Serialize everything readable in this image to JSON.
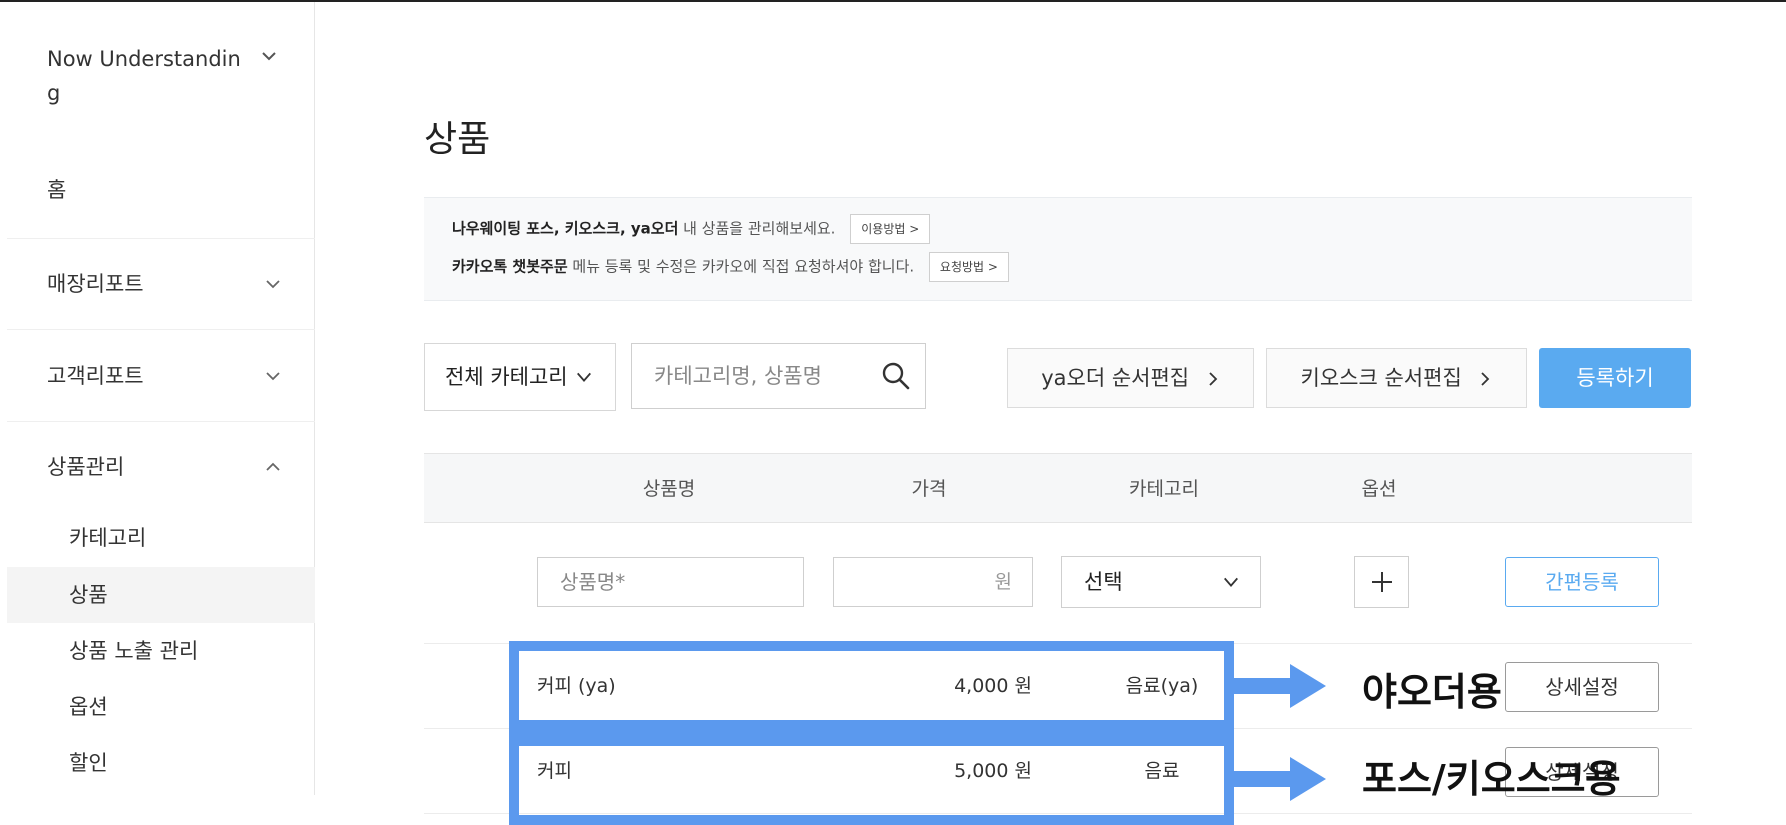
{
  "sidebar": {
    "store_name": "Now Understanding",
    "home": "홈",
    "items": [
      {
        "label": "매장리포트"
      },
      {
        "label": "고객리포트"
      },
      {
        "label": "상품관리"
      }
    ],
    "sub_items": [
      {
        "label": "카테고리"
      },
      {
        "label": "상품"
      },
      {
        "label": "상품 노출 관리"
      },
      {
        "label": "옵션"
      },
      {
        "label": "할인"
      }
    ]
  },
  "main": {
    "title": "상품",
    "notice": {
      "line1_bold": "나우웨이팅 포스, 키오스크, ya오더",
      "line1_text": " 내 상품을 관리해보세요.",
      "line1_button": "이용방법 >",
      "line2_bold": "카카오톡 챗봇주문",
      "line2_text": " 메뉴 등록 및 수정은 카카오에 직접 요청하셔야 합니다.",
      "line2_button": "요청방법 >"
    },
    "toolbar": {
      "category_select": "전체 카테고리",
      "search_placeholder": "카테고리명, 상품명",
      "ya_order_button": "ya오더 순서편집",
      "kiosk_button": "키오스크 순서편집",
      "register_button": "등록하기"
    },
    "table": {
      "headers": [
        "상품명",
        "가격",
        "카테고리",
        "옵션"
      ],
      "input_row": {
        "name_placeholder": "상품명",
        "name_required": "*",
        "price_unit": "원",
        "category_select": "선택",
        "quick_register": "간편등록"
      },
      "rows": [
        {
          "name": "커피 (ya)",
          "price": "4,000 원",
          "category": "음료(ya)",
          "action": "상세설정"
        },
        {
          "name": "커피",
          "price": "5,000 원",
          "category": "음료",
          "action": "상세설정"
        }
      ]
    }
  },
  "annotations": {
    "callout1": "야오더용",
    "callout2": "포스/키오스크용",
    "color": "#5b99ee"
  }
}
